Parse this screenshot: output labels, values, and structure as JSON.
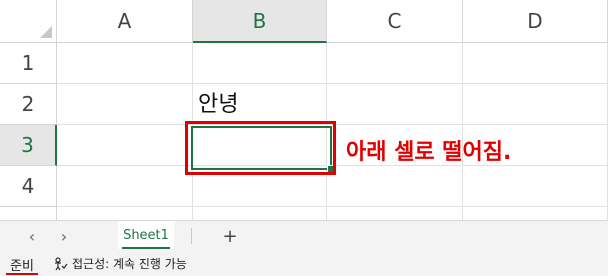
{
  "columns": [
    "A",
    "B",
    "C",
    "D"
  ],
  "rows": [
    "1",
    "2",
    "3",
    "4"
  ],
  "selected_column": "B",
  "selected_row": "3",
  "cells": {
    "B2": "안녕",
    "B3": ""
  },
  "annotation": "아래 셀로 떨어짐.",
  "sheet_tabs": [
    "Sheet1"
  ],
  "add_sheet_label": "+",
  "nav": {
    "prev": "‹",
    "next": "›"
  },
  "status": {
    "ready": "준비",
    "accessibility": "접근성: 계속 진행 가능"
  },
  "colors": {
    "accent": "#217346",
    "annotation": "#e00000"
  }
}
